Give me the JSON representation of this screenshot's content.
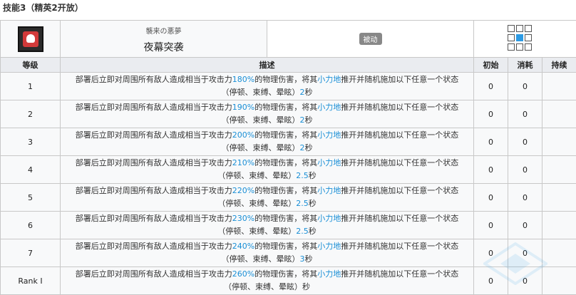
{
  "section_title": "技能3（精英2开放）",
  "skill": {
    "icon": "skull-icon",
    "sub_name": "襲来の悪夢",
    "name": "夜幕突袭",
    "type_badge": "被动"
  },
  "headers": {
    "level": "等级",
    "desc": "描述",
    "initial": "初始",
    "cost": "消耗",
    "duration": "持续"
  },
  "rows": [
    {
      "level": "1",
      "atk": "180%",
      "dur": "2",
      "init": "0",
      "cost": "0"
    },
    {
      "level": "2",
      "atk": "190%",
      "dur": "2",
      "init": "0",
      "cost": "0"
    },
    {
      "level": "3",
      "atk": "200%",
      "dur": "2",
      "init": "0",
      "cost": "0"
    },
    {
      "level": "4",
      "atk": "210%",
      "dur": "2.5",
      "init": "0",
      "cost": "0"
    },
    {
      "level": "5",
      "atk": "220%",
      "dur": "2.5",
      "init": "0",
      "cost": "0"
    },
    {
      "level": "6",
      "atk": "230%",
      "dur": "2.5",
      "init": "0",
      "cost": "0"
    },
    {
      "level": "7",
      "atk": "240%",
      "dur": "3",
      "init": "0",
      "cost": "0"
    },
    {
      "level": "Rank I",
      "atk": "260%",
      "dur": "",
      "init": "0",
      "cost": "0"
    }
  ],
  "desc_parts": {
    "p1": "部署后立即对周围所有敌人造成相当于攻击力",
    "p2": "的物理伤害，将其",
    "p3": "小力地",
    "p4": "推开并随机施加以下任意一个状态",
    "p5": "（停顿、束缚、晕眩）",
    "p6": "秒"
  },
  "colors": {
    "highlight": "#1a8fd6",
    "range_on": "#2d9be4"
  }
}
